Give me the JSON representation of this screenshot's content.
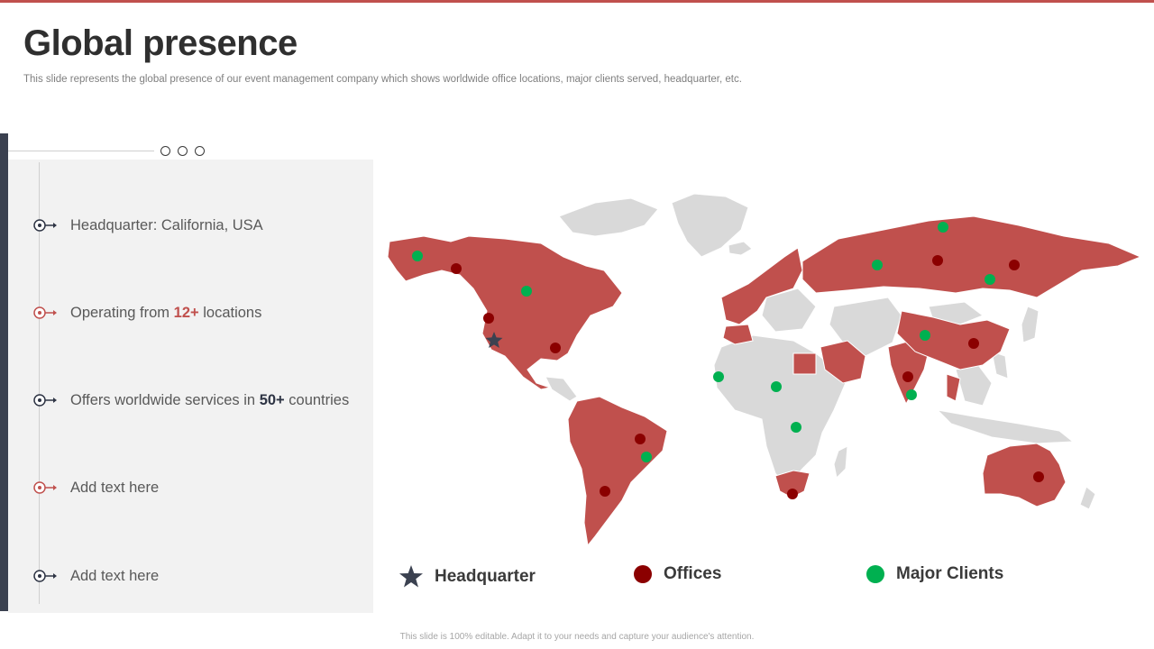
{
  "slide": {
    "title": "Global presence",
    "subtitle": "This slide represents the global presence of our event management company which shows worldwide office locations, major clients served, headquarter, etc.",
    "footer": "This slide is 100% editable. Adapt it to your needs and capture your audience's attention."
  },
  "items": [
    {
      "icon": "arrow-dark-icon",
      "before": "Headquarter: California, USA",
      "highlight": "",
      "after": ""
    },
    {
      "icon": "arrow-red-icon",
      "before": "Operating from ",
      "highlight": "12+",
      "after": " locations"
    },
    {
      "icon": "arrow-dark-icon",
      "before": "Offers worldwide services in ",
      "highlight": "50+",
      "after": " countries"
    },
    {
      "icon": "arrow-red-icon",
      "before": "Add text here",
      "highlight": "",
      "after": ""
    },
    {
      "icon": "arrow-dark-icon",
      "before": "Add text here",
      "highlight": "",
      "after": ""
    }
  ],
  "legend": {
    "headquarter": "Headquarter",
    "offices": "Offices",
    "major_clients": "Major Clients"
  },
  "colors": {
    "accent": "#c0504d",
    "dark": "#3b4150",
    "office": "#8b0000",
    "client": "#00b050",
    "land": "#d9d9d9",
    "panel": "#f2f2f2"
  }
}
